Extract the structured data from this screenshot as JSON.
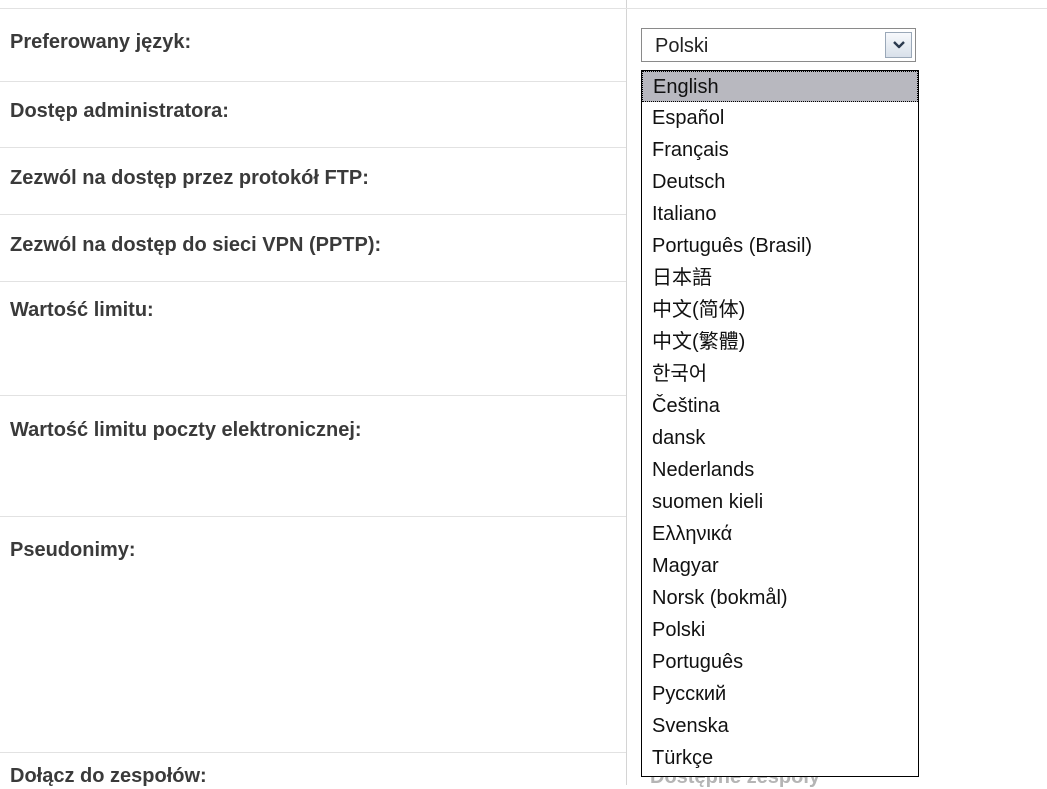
{
  "form": {
    "rows": [
      {
        "label": "Preferowany język:"
      },
      {
        "label": "Dostęp administratora:"
      },
      {
        "label": "Zezwól na dostęp przez protokół FTP:"
      },
      {
        "label": "Zezwól na dostęp do sieci VPN (PPTP):"
      },
      {
        "label": "Wartość limitu:"
      },
      {
        "label": "Wartość limitu poczty elektronicznej:"
      },
      {
        "label": "Pseudonimy:"
      },
      {
        "label": "Dołącz do zespołów:"
      }
    ],
    "peek_text": "Dostępne zespoły"
  },
  "language_select": {
    "selected_value": "Polski",
    "highlighted_option": "English",
    "options": [
      "English",
      "Español",
      "Français",
      "Deutsch",
      "Italiano",
      "Português (Brasil)",
      "日本語",
      "中文(简体)",
      "中文(繁體)",
      "한국어",
      "Čeština",
      "dansk",
      "Nederlands",
      "suomen kieli",
      "Ελληνικά",
      "Magyar",
      "Norsk (bokmål)",
      "Polski",
      "Português",
      "Русский",
      "Svenska",
      "Türkçe"
    ]
  }
}
